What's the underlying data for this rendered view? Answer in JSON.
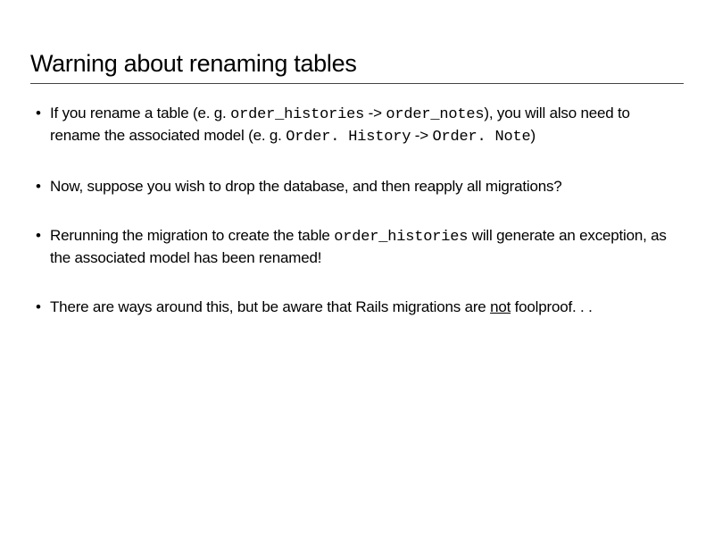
{
  "title": "Warning about renaming tables",
  "bullets": [
    {
      "t1": "If you rename a table (e. g. ",
      "c1": "order_histories",
      "t2": " -> ",
      "c2": "order_notes",
      "t3": "), you will also need to rename the associated model (e. g. ",
      "c3": "Order. History",
      "t4": " -> ",
      "c4": "Order. Note",
      "t5": ")"
    },
    {
      "t1": "Now, suppose you wish to drop the database, and then reapply all migrations?"
    },
    {
      "t1": "Rerunning the migration to create the table ",
      "c1": "order_histories",
      "t2": " will generate an exception, as the associated model has been renamed!"
    },
    {
      "t1": "There are ways around this, but be aware that Rails migrations are ",
      "u1": "not",
      "t2": " foolproof. . ."
    }
  ]
}
